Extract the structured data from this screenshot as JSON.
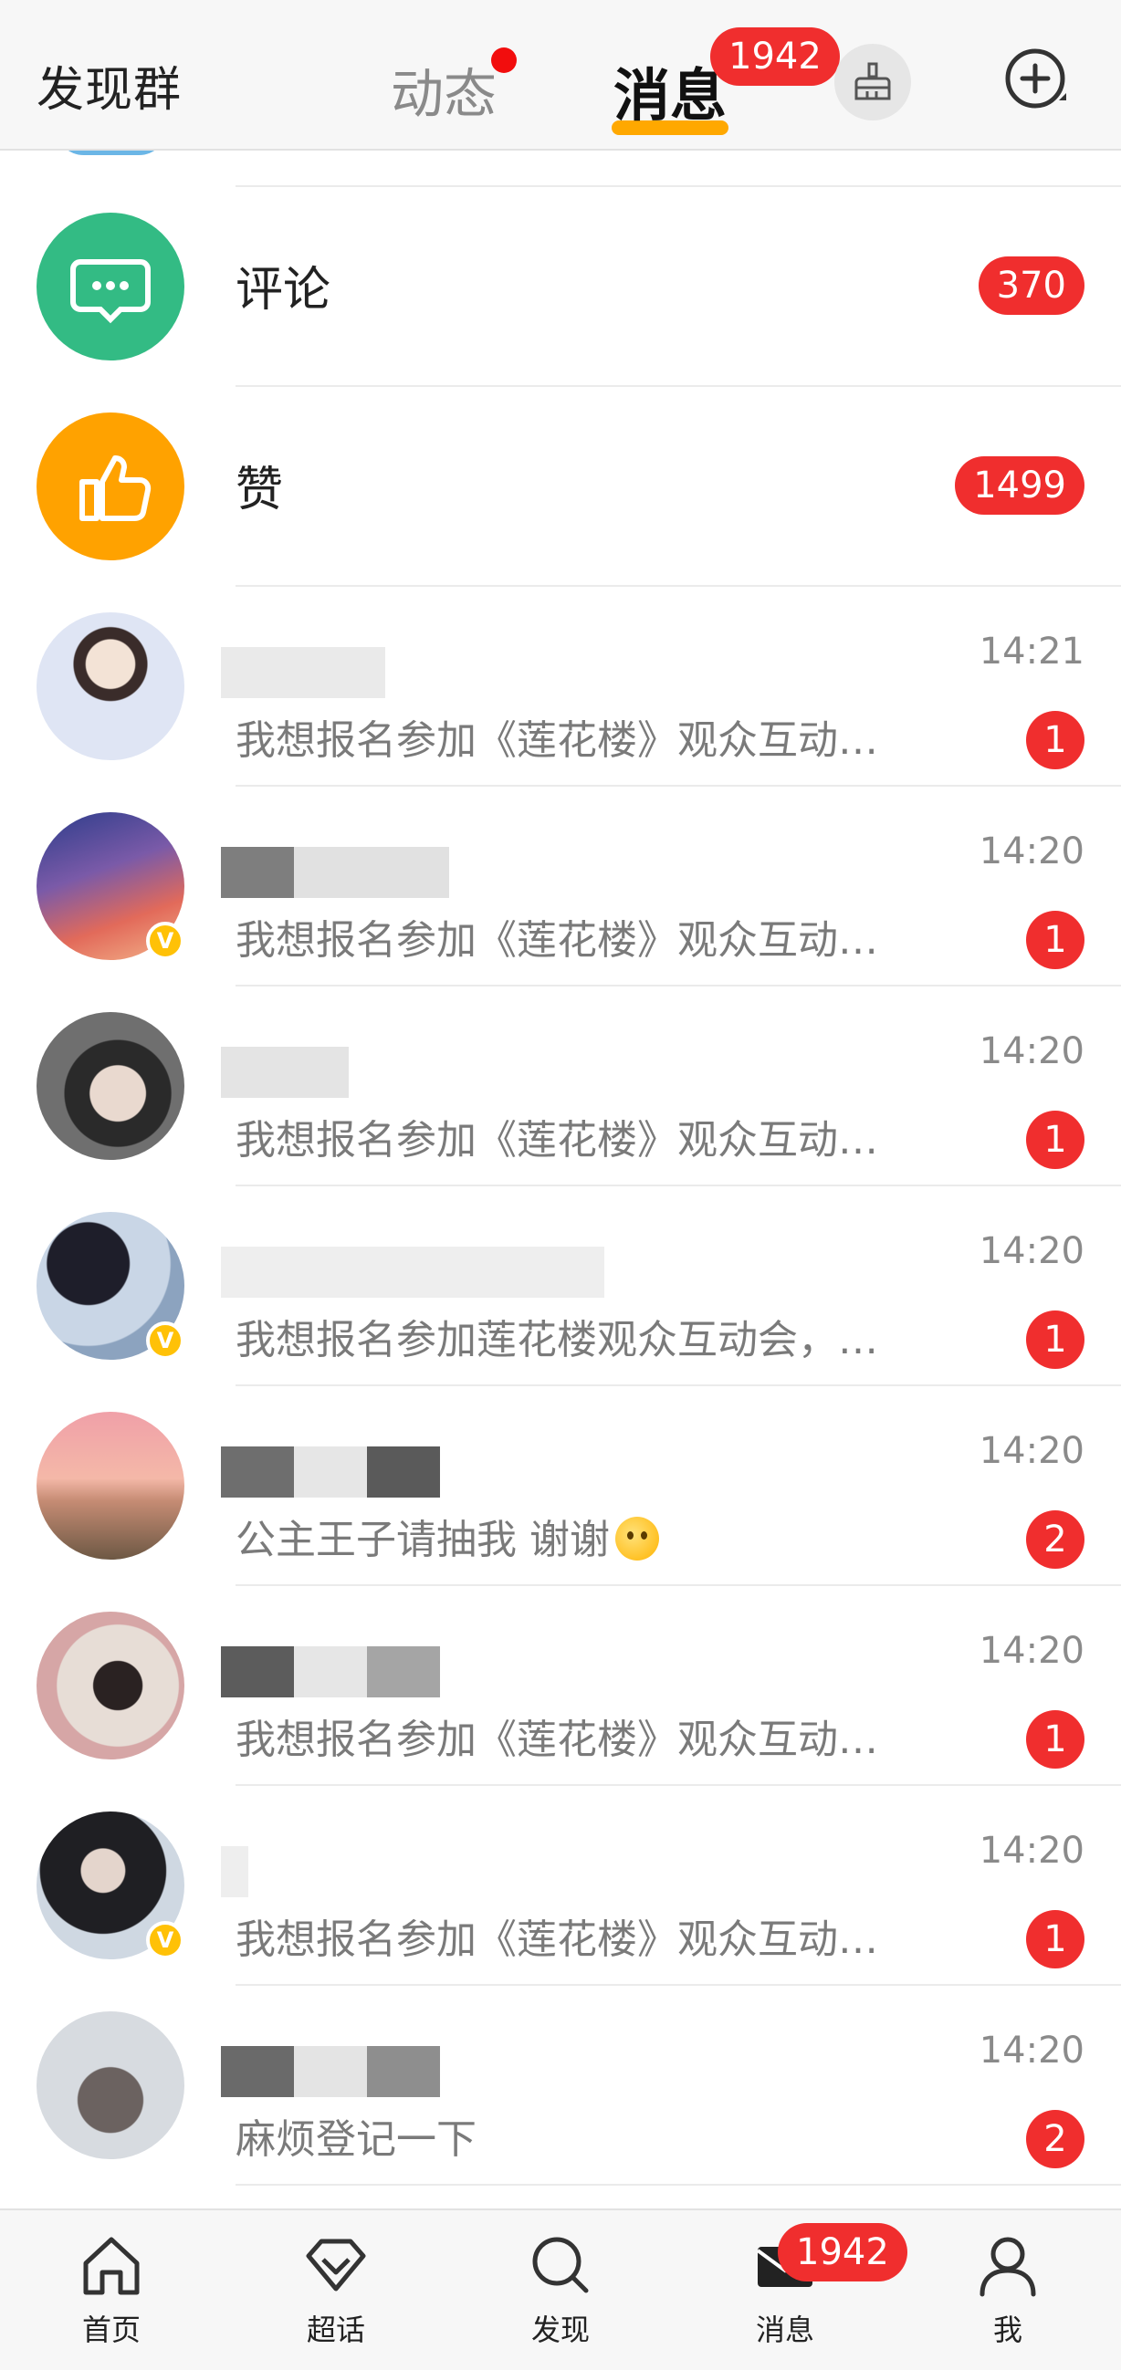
{
  "topbar": {
    "left_label": "发现群",
    "tab_feed": "动态",
    "tab_messages": "消息",
    "messages_badge": "1942"
  },
  "system_rows": [
    {
      "icon": "comment-icon",
      "title": "评论",
      "badge": "370",
      "color": "#33bb84"
    },
    {
      "icon": "thumbs-up-icon",
      "title": "赞",
      "badge": "1499",
      "color": "#ffa200"
    }
  ],
  "conversations": [
    {
      "time": "14:21",
      "preview": "我想报名参加《莲花楼》观众互动…",
      "unread": "1",
      "verified": false
    },
    {
      "time": "14:20",
      "preview": "我想报名参加《莲花楼》观众互动…",
      "unread": "1",
      "verified": true
    },
    {
      "time": "14:20",
      "preview": "我想报名参加《莲花楼》观众互动…",
      "unread": "1",
      "verified": false
    },
    {
      "time": "14:20",
      "preview": "我想报名参加莲花楼观众互动会，…",
      "unread": "1",
      "verified": true
    },
    {
      "time": "14:20",
      "preview": "公主王子请抽我  谢谢",
      "unread": "2",
      "verified": false
    },
    {
      "time": "14:20",
      "preview": "我想报名参加《莲花楼》观众互动…",
      "unread": "1",
      "verified": false
    },
    {
      "time": "14:20",
      "preview": "我想报名参加《莲花楼》观众互动…",
      "unread": "1",
      "verified": true
    },
    {
      "time": "14:20",
      "preview": "麻烦登记一下",
      "unread": "2",
      "verified": false
    }
  ],
  "verified_mark": "V",
  "bottom_nav": {
    "home": "首页",
    "super_topic": "超话",
    "discover": "发现",
    "messages": "消息",
    "me": "我",
    "messages_badge": "1942"
  },
  "colors": {
    "accent": "#ffa800",
    "badge_red": "#f02e2e",
    "comment_green": "#33bb84",
    "like_orange": "#ffa200"
  }
}
